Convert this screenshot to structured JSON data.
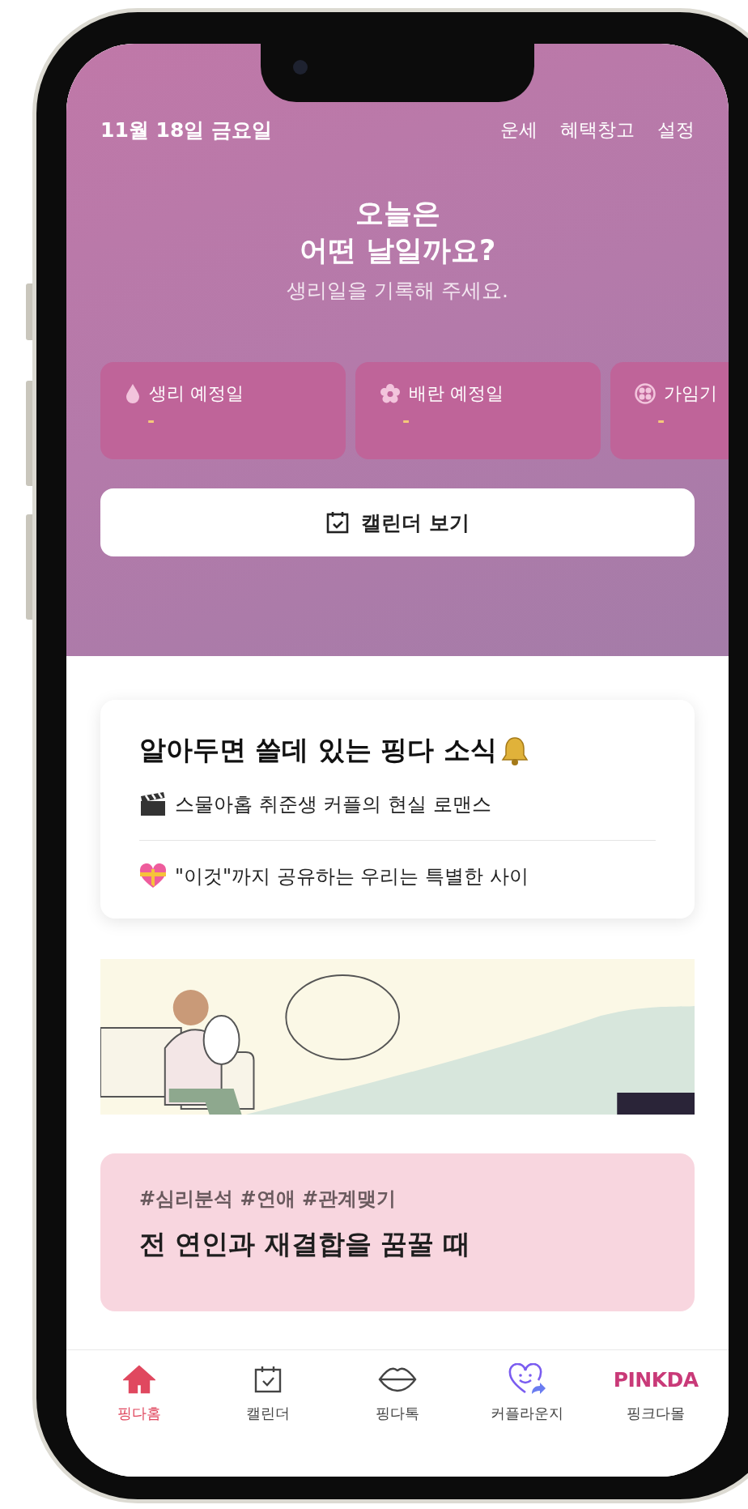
{
  "header": {
    "date": "11월 18일 금요일",
    "links": [
      "운세",
      "혜택창고",
      "설정"
    ],
    "headline": "오늘은\n어떤 날일까요?",
    "subtitle": "생리일을 기록해 주세요."
  },
  "predictions": [
    {
      "kind": "drop",
      "label": "생리 예정일",
      "value": "-"
    },
    {
      "kind": "flower",
      "label": "배란 예정일",
      "value": "-"
    },
    {
      "kind": "ring",
      "label": "가임기",
      "value": "-"
    }
  ],
  "calendar_button": {
    "label": "캘린더 보기"
  },
  "news": {
    "title": "알아두면 쓸데 있는 핑다 소식",
    "items": [
      {
        "kind": "clapper",
        "text": "스물아홉 취준생 커플의 현실 로맨스"
      },
      {
        "kind": "gift-heart",
        "text": "\"이것\"까지 공유하는 우리는 특별한 사이"
      }
    ]
  },
  "article": {
    "tags": "#심리분석 #연애 #관계맺기",
    "title": "전 연인과 재결합을 꿈꿀 때"
  },
  "bottom_nav": [
    {
      "kind": "home",
      "label": "핑다홈",
      "selected": true
    },
    {
      "kind": "calendar",
      "label": "캘린더",
      "selected": false
    },
    {
      "kind": "lips",
      "label": "핑다톡",
      "selected": false
    },
    {
      "kind": "heart",
      "label": "커플라운지",
      "selected": false
    },
    {
      "kind": "logo",
      "logo": "PINKDA",
      "label": "핑크다몰",
      "selected": false
    }
  ]
}
